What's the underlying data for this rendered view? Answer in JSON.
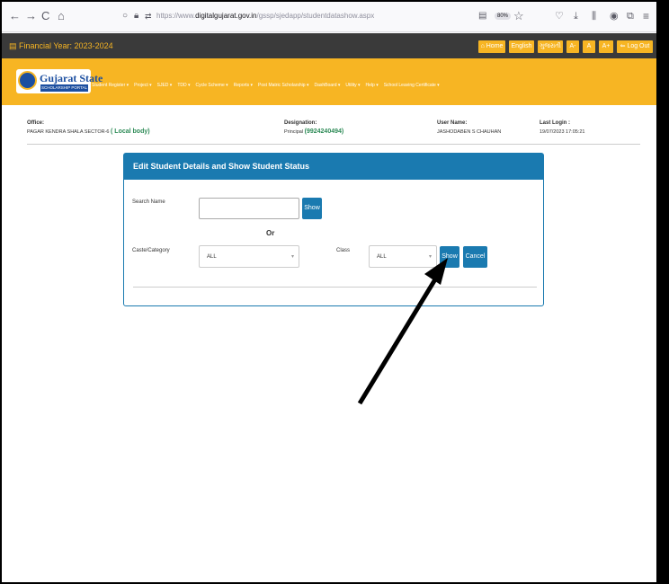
{
  "browser": {
    "back_icon": "←",
    "forward_icon": "→",
    "reload_icon": "C",
    "home_icon": "⌂",
    "url_prefix": "https://www.",
    "url_domain": "digitalgujarat.gov.in",
    "url_path": "/gssp/sjedapp/studentdatashow.aspx",
    "zoom": "80%"
  },
  "fy_bar": {
    "label": "Financial Year: 2023-2024",
    "buttons": [
      "Home",
      "English",
      "ગુજરાતી",
      "A-",
      "A",
      "A+",
      "Log Out"
    ]
  },
  "header": {
    "logo_title": "Gujarat State",
    "logo_sub": "SCHOLARSHIP PORTAL",
    "nav": [
      "Student Register ▾",
      "Project ▾",
      "SJED ▾",
      "TDD ▾",
      "Cycle Scheme ▾",
      "Reports ▾",
      "Post Matric Scholarship ▾",
      "DashBoard ▾",
      "Utility ▾",
      "Help ▾",
      "School Leaving Certificate ▾"
    ]
  },
  "user_info": {
    "office_label": "Office:",
    "office_value": "PAGAR KENDRA SHALA SECTOR-6",
    "office_badge": "( Local body)",
    "designation_label": "Designation:",
    "designation_value": "Principal",
    "designation_phone": "(9924240494)",
    "username_label": "User Name:",
    "username_value": "JASHODABEN S CHAUHAN",
    "lastlogin_label": "Last Login :",
    "lastlogin_value": "19/07/2023 17:05:21"
  },
  "panel": {
    "title": "Edit Student Details and Show Student Status",
    "search_name_label": "Search Name",
    "search_name_value": "",
    "show_button": "Show",
    "or_label": "Or",
    "caste_label": "Caste/Category",
    "caste_selected": "ALL",
    "class_label": "Class",
    "class_selected": "ALL",
    "show_button_2": "Show",
    "cancel_button": "Cancel"
  },
  "colors": {
    "brand_orange": "#f7b523",
    "primary_blue": "#1a7ab0",
    "dark_bar": "#3a3a3a",
    "green_text": "#2e8b57"
  }
}
